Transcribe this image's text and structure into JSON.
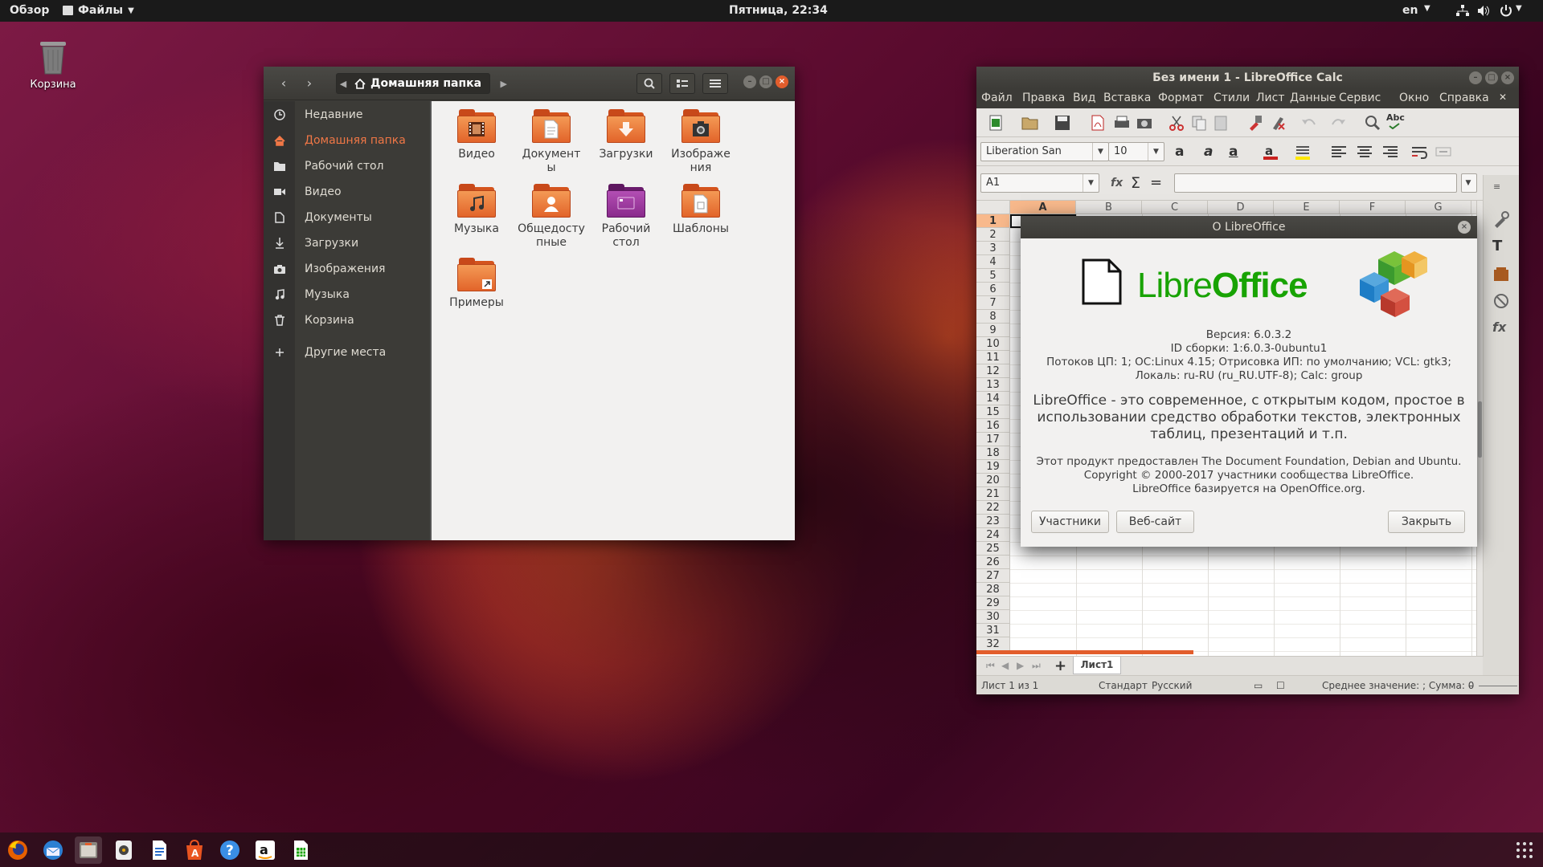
{
  "topbar": {
    "activities": "Обзор",
    "app_menu": "Файлы",
    "clock": "Пятница, 22:34",
    "lang": "en"
  },
  "desktop": {
    "trash_label": "Корзина"
  },
  "files": {
    "path": "Домашняя папка",
    "sidebar": [
      {
        "label": "Недавние",
        "icon": "clock-icon"
      },
      {
        "label": "Домашняя папка",
        "icon": "home-icon",
        "active": true
      },
      {
        "label": "Рабочий стол",
        "icon": "folder-icon"
      },
      {
        "label": "Видео",
        "icon": "video-icon"
      },
      {
        "label": "Документы",
        "icon": "document-icon"
      },
      {
        "label": "Загрузки",
        "icon": "download-icon"
      },
      {
        "label": "Изображения",
        "icon": "camera-icon"
      },
      {
        "label": "Музыка",
        "icon": "music-icon"
      },
      {
        "label": "Корзина",
        "icon": "trash-icon"
      },
      {
        "label": "Другие места",
        "icon": "plus-icon"
      }
    ],
    "folders": [
      {
        "line1": "Видео",
        "line2": ""
      },
      {
        "line1": "Документ",
        "line2": "ы"
      },
      {
        "line1": "Загрузки",
        "line2": ""
      },
      {
        "line1": "Изображе",
        "line2": "ния"
      },
      {
        "line1": "Музыка",
        "line2": ""
      },
      {
        "line1": "Общедосту",
        "line2": "пные"
      },
      {
        "line1": "Рабочий",
        "line2": "стол"
      },
      {
        "line1": "Шаблоны",
        "line2": ""
      },
      {
        "line1": "Примеры",
        "line2": ""
      }
    ]
  },
  "calc": {
    "title": "Без имени 1 - LibreOffice Calc",
    "menu": [
      "Файл",
      "Правка",
      "Вид",
      "Вставка",
      "Формат",
      "Стили",
      "Лист",
      "Данные",
      "Сервис",
      "Окно",
      "Справка"
    ],
    "font_name": "Liberation San",
    "font_size": "10",
    "cell_ref": "A1",
    "columns": [
      "A",
      "B",
      "C",
      "D",
      "E",
      "F",
      "G"
    ],
    "rows": [
      "1",
      "2",
      "3",
      "4",
      "5",
      "6",
      "7",
      "8",
      "9",
      "10",
      "11",
      "12",
      "13",
      "14",
      "15",
      "16",
      "17",
      "18",
      "19",
      "20",
      "21",
      "22",
      "23",
      "24",
      "25",
      "26",
      "27",
      "28",
      "29",
      "30",
      "31",
      "32"
    ],
    "sheet_tab": "Лист1",
    "status": {
      "sheet": "Лист 1 из 1",
      "style": "Стандарт",
      "language": "Русский",
      "summary": "Среднее значение: ; Сумма: 0"
    }
  },
  "about": {
    "title": "О LibreOffice",
    "logo_libre": "Libre",
    "logo_office": "Office",
    "version": "Версия: 6.0.3.2",
    "build": "ID сборки: 1:6.0.3-0ubuntu1",
    "threads": "Потоков ЦП: 1; ОС:Linux 4.15; Отрисовка ИП: по умолчанию; VCL: gtk3;",
    "locale": "Локаль: ru-RU (ru_RU.UTF-8); Calc: group",
    "desc1": "LibreOffice - это современное, с открытым кодом, простое в",
    "desc2": "использовании средство обработки текстов, электронных",
    "desc3": "таблиц, презентаций и т.п.",
    "credit1": "Этот продукт предоставлен The Document Foundation, Debian and Ubuntu.",
    "credit2": "Copyright © 2000-2017 участники сообщества LibreOffice.",
    "credit3": "LibreOffice базируется на OpenOffice.org.",
    "btn_credits": "Участники",
    "btn_website": "Веб-сайт",
    "btn_close": "Закрыть"
  },
  "colors": {
    "accent": "#f07746",
    "lo_green": "#18a303",
    "folder_orange": "#e2642a"
  }
}
